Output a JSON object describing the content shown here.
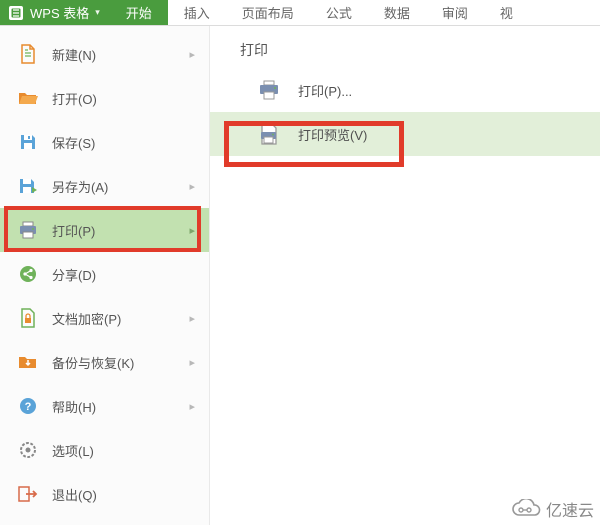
{
  "app": {
    "name": "WPS 表格"
  },
  "tabs": [
    {
      "label": "开始",
      "active": true
    },
    {
      "label": "插入"
    },
    {
      "label": "页面布局"
    },
    {
      "label": "公式"
    },
    {
      "label": "数据"
    },
    {
      "label": "审阅"
    },
    {
      "label": "视"
    }
  ],
  "sidebar": {
    "items": [
      {
        "label": "新建(N)",
        "icon": "file-new",
        "arrow": true
      },
      {
        "label": "打开(O)",
        "icon": "folder-open"
      },
      {
        "label": "保存(S)",
        "icon": "save"
      },
      {
        "label": "另存为(A)",
        "icon": "save-as",
        "arrow": true
      },
      {
        "label": "打印(P)",
        "icon": "print",
        "arrow": true,
        "selected": true
      },
      {
        "label": "分享(D)",
        "icon": "share"
      },
      {
        "label": "文档加密(P)",
        "icon": "encrypt",
        "arrow": true
      },
      {
        "label": "备份与恢复(K)",
        "icon": "backup",
        "arrow": true
      },
      {
        "label": "帮助(H)",
        "icon": "help",
        "arrow": true
      },
      {
        "label": "选项(L)",
        "icon": "options"
      },
      {
        "label": "退出(Q)",
        "icon": "exit"
      }
    ]
  },
  "panel": {
    "title": "打印",
    "items": [
      {
        "label": "打印(P)...",
        "icon": "print"
      },
      {
        "label": "打印预览(V)",
        "icon": "print-preview",
        "highlight": true
      }
    ]
  },
  "watermark": {
    "text": "亿速云"
  },
  "colors": {
    "accent": "#4a9c3e",
    "highlight_red": "#e13b2a"
  }
}
